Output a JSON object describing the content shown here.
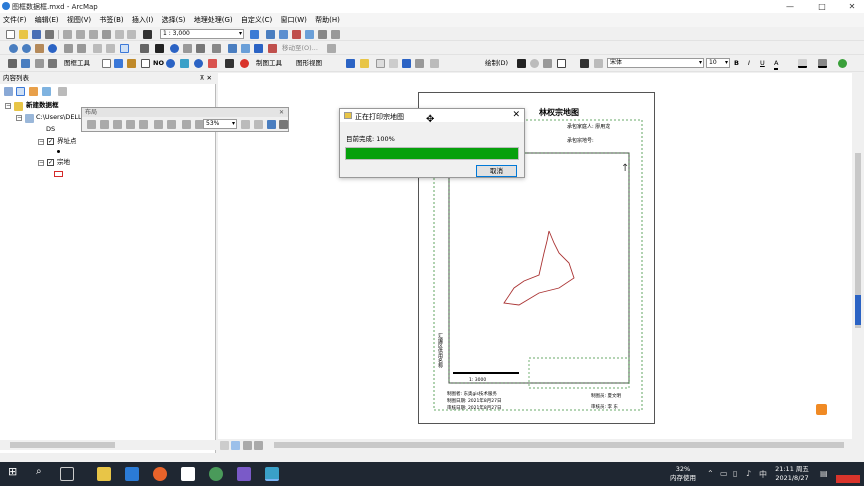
{
  "window": {
    "title": "图框数据框.mxd - ArcMap",
    "min": "—",
    "max": "□",
    "close": "✕"
  },
  "menu": [
    "文件(F)",
    "编辑(E)",
    "视图(V)",
    "书签(B)",
    "插入(I)",
    "选择(S)",
    "地理处理(G)",
    "自定义(C)",
    "窗口(W)",
    "帮助(H)"
  ],
  "toolbar": {
    "scale": "1 : 3,000",
    "move_to": "移动至(O)...",
    "frame_tools": "图框工具",
    "drawing_tools": "制图工具",
    "graphic_view": "图形视图",
    "draw": "绘制(D)",
    "font": "宋体",
    "font_size": "10",
    "bold": "B",
    "italic": "I",
    "underline": "U",
    "font_color_letter": "A"
  },
  "toc": {
    "title": "内容列表",
    "pin": "⊼ ✕",
    "dataframe": "新建数据框",
    "path": "C:\\Users\\DELL",
    "folder": "DS",
    "layers": [
      {
        "name": "界址点",
        "checked": "✓"
      },
      {
        "name": "宗地",
        "checked": "✓"
      }
    ]
  },
  "layout_toolbar": {
    "title": "布局",
    "zoom": "53%"
  },
  "dialog": {
    "title": "正在打印宗地图",
    "label": "目前完成: 100%",
    "progress": 1.0,
    "cancel": "取消"
  },
  "map_page": {
    "title": "林权宗地图",
    "row1": "承包家庭人: 廖用龙",
    "row2": "承包宗地号: ",
    "scale_label": "1: 3000",
    "side_text": "汇编区供用名称",
    "bottom1": "制图者: 东奥gis技术服务",
    "bottom2": "制图日期: 2021年8月27日",
    "bottom3": "审核日期: 2021年8月27日",
    "bottom_right1": "制图员: 夏文明",
    "bottom_right2": "审核员: 李 东"
  },
  "taskbar": {
    "cpu": "32%",
    "mem": "内存使用",
    "time": "21:11 周五",
    "date": "2021/8/27"
  },
  "colors": {
    "progress": "#06a00c",
    "taskbar": "#1f2732",
    "accent": "#0078d7"
  }
}
